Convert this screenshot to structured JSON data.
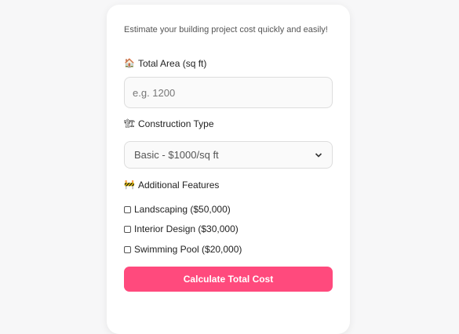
{
  "subtitle": "Estimate your building project cost quickly and easily!",
  "area": {
    "icon": "house-icon",
    "label": "Total Area (sq ft)",
    "placeholder": "e.g. 1200"
  },
  "construction": {
    "icon": "crane-icon",
    "label": "Construction Type",
    "selected": "Basic - $1000/sq ft"
  },
  "features": {
    "icon": "construction-barrier-icon",
    "label": "Additional Features",
    "items": [
      {
        "label": "Landscaping ($50,000)",
        "checked": false
      },
      {
        "label": "Interior Design ($30,000)",
        "checked": false
      },
      {
        "label": "Swimming Pool ($20,000)",
        "checked": false
      }
    ]
  },
  "button": {
    "label": "Calculate Total Cost"
  },
  "colors": {
    "accent": "#ff4a7d",
    "background": "#f7f7f8",
    "card": "#ffffff"
  }
}
